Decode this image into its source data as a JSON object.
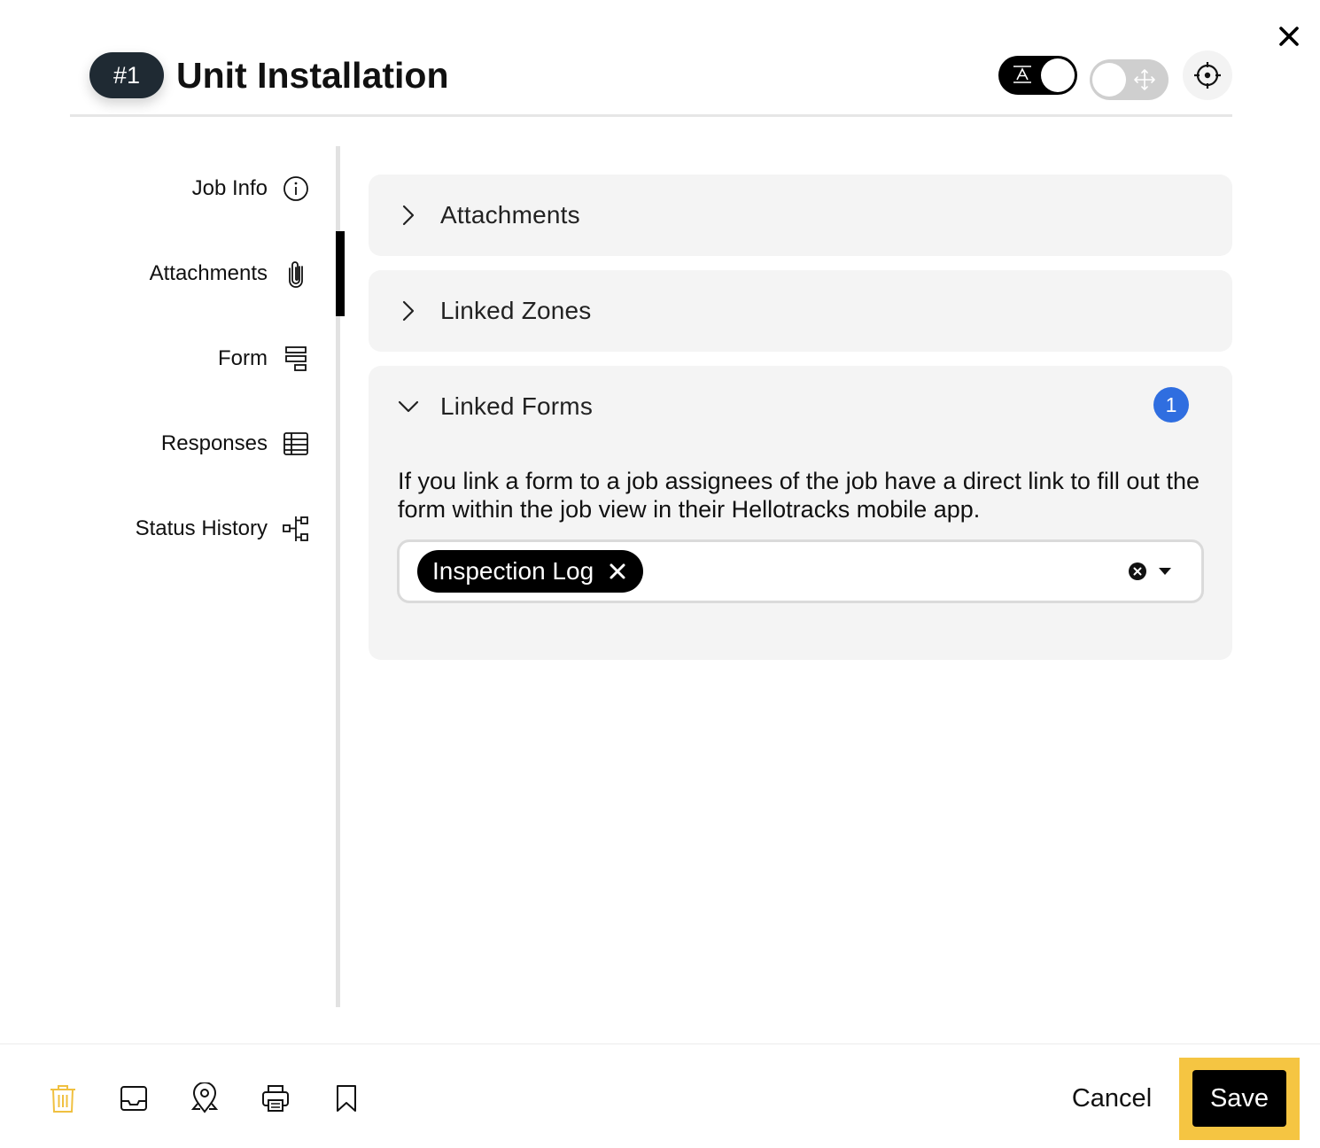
{
  "header": {
    "job_number": "#1",
    "title": "Unit Installation",
    "toggle_text_icon": "text-format-icon",
    "toggle_move_icon": "move-arrows-icon",
    "locate_icon": "crosshair-icon",
    "close_icon": "close-icon"
  },
  "sidebar": {
    "items": [
      {
        "label": "Job Info",
        "icon": "info-icon"
      },
      {
        "label": "Attachments",
        "icon": "paperclip-icon",
        "active": true
      },
      {
        "label": "Form",
        "icon": "form-icon"
      },
      {
        "label": "Responses",
        "icon": "table-icon"
      },
      {
        "label": "Status History",
        "icon": "hierarchy-icon"
      }
    ]
  },
  "main": {
    "sections": [
      {
        "title": "Attachments",
        "expanded": false
      },
      {
        "title": "Linked Zones",
        "expanded": false
      },
      {
        "title": "Linked Forms",
        "expanded": true,
        "count": "1",
        "description": "If you link a form to a job assignees of the job have a direct link to fill out the form within the job view in their Hellotracks mobile app.",
        "selected_forms": [
          "Inspection Log"
        ]
      }
    ]
  },
  "footer": {
    "icons": [
      "trash-icon",
      "inbox-icon",
      "map-pin-icon",
      "printer-icon",
      "bookmark-icon"
    ],
    "cancel_label": "Cancel",
    "save_label": "Save"
  },
  "colors": {
    "accent_badge": "#2f6ee0",
    "save_highlight": "#f5c542",
    "trash": "#f0c040",
    "dark": "#000000",
    "panel_bg": "#f4f4f4"
  }
}
